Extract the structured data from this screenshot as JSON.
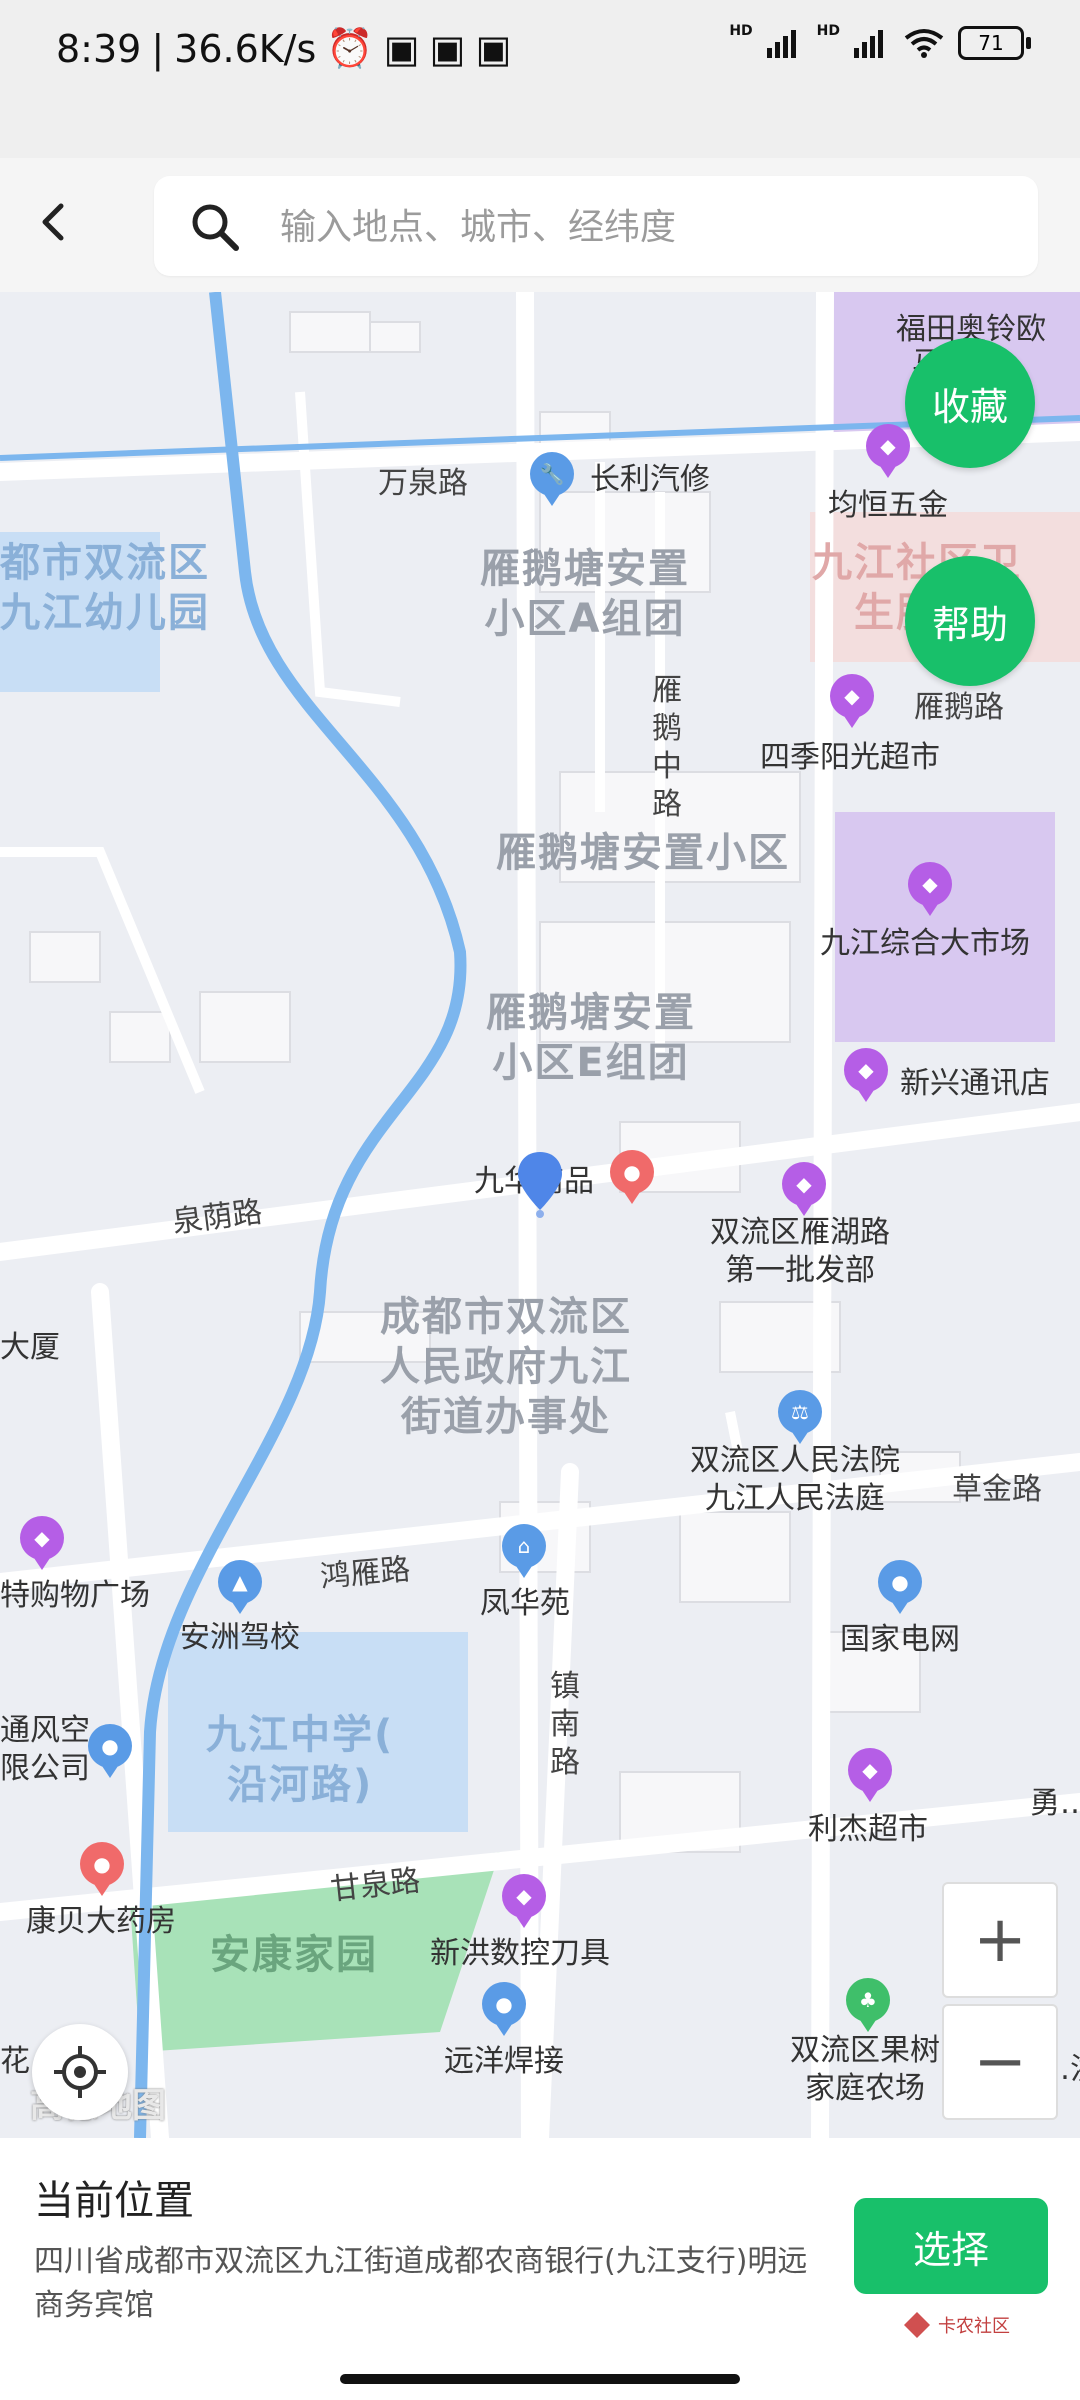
{
  "status_bar": {
    "time": "8:39",
    "speed": "36.6K/s",
    "hd1": "HD",
    "hd2": "HD",
    "battery": "71"
  },
  "search": {
    "placeholder": "输入地点、城市、经纬度"
  },
  "map": {
    "labels": {
      "fukuda": "福田奥铃欧",
      "fukuda2": "马…件",
      "wanquan_road": "万泉路",
      "changli": "长利汽修",
      "junheng": "均恒五金",
      "district_kg": "都市双流区\n九江幼儿园",
      "yanetang_a": "雁鹅塘安置\n小区A组团",
      "jiujiang_health": "九江社区卫\n生服…",
      "yane_road": "雁鹅路",
      "yanezhong_road": "雁\n鹅\n中\n路",
      "sijiyangguang": "四季阳光超市",
      "yanetang": "雁鹅塘安置小区",
      "jiujiang_market": "九江综合大市场",
      "yanetang_e": "雁鹅塘安置\n小区E组团",
      "xinxing": "新兴通讯店",
      "quanyin_road": "泉荫路",
      "jiuhua": "九华商品",
      "shuangliu_yanhu": "双流区雁湖路\n第一批发部",
      "gov_office": "成都市双流区\n人民政府九江\n街道办事处",
      "dasha": "大厦",
      "court": "双流区人民法院\n九江人民法庭",
      "caojin_road": "草金路",
      "shopping": "特购物广场",
      "hongyan_road": "鸿雁路",
      "anzhou_school": "安洲驾校",
      "fenghuayuan": "凤华苑",
      "guojia_dianwang": "国家电网",
      "zhennan_road": "镇\n南\n路",
      "jiujiang_middle": "九江中学(\n沿河路)",
      "tongfeng": "通风空\n限公司",
      "lijie": "利杰超市",
      "yong": "勇…",
      "kangbei": "康贝大药房",
      "ganquan_road": "甘泉路",
      "xinhong": "新洪数控刀具",
      "ankang": "安康家园",
      "yuanyang": "远洋焊接",
      "guoshu": "双流区果树\n家庭农场",
      "hong": "…洪",
      "hua": "花",
      "amap": "高德地图"
    },
    "buttons": {
      "favorite": "收藏",
      "help": "帮助",
      "zoom_in": "+",
      "zoom_out": "−"
    }
  },
  "bottom_panel": {
    "title": "当前位置",
    "address": "四川省成都市双流区九江街道成都农商银行(九江支行)明远商务宾馆",
    "select_label": "选择",
    "watermark": "卡农社区"
  }
}
